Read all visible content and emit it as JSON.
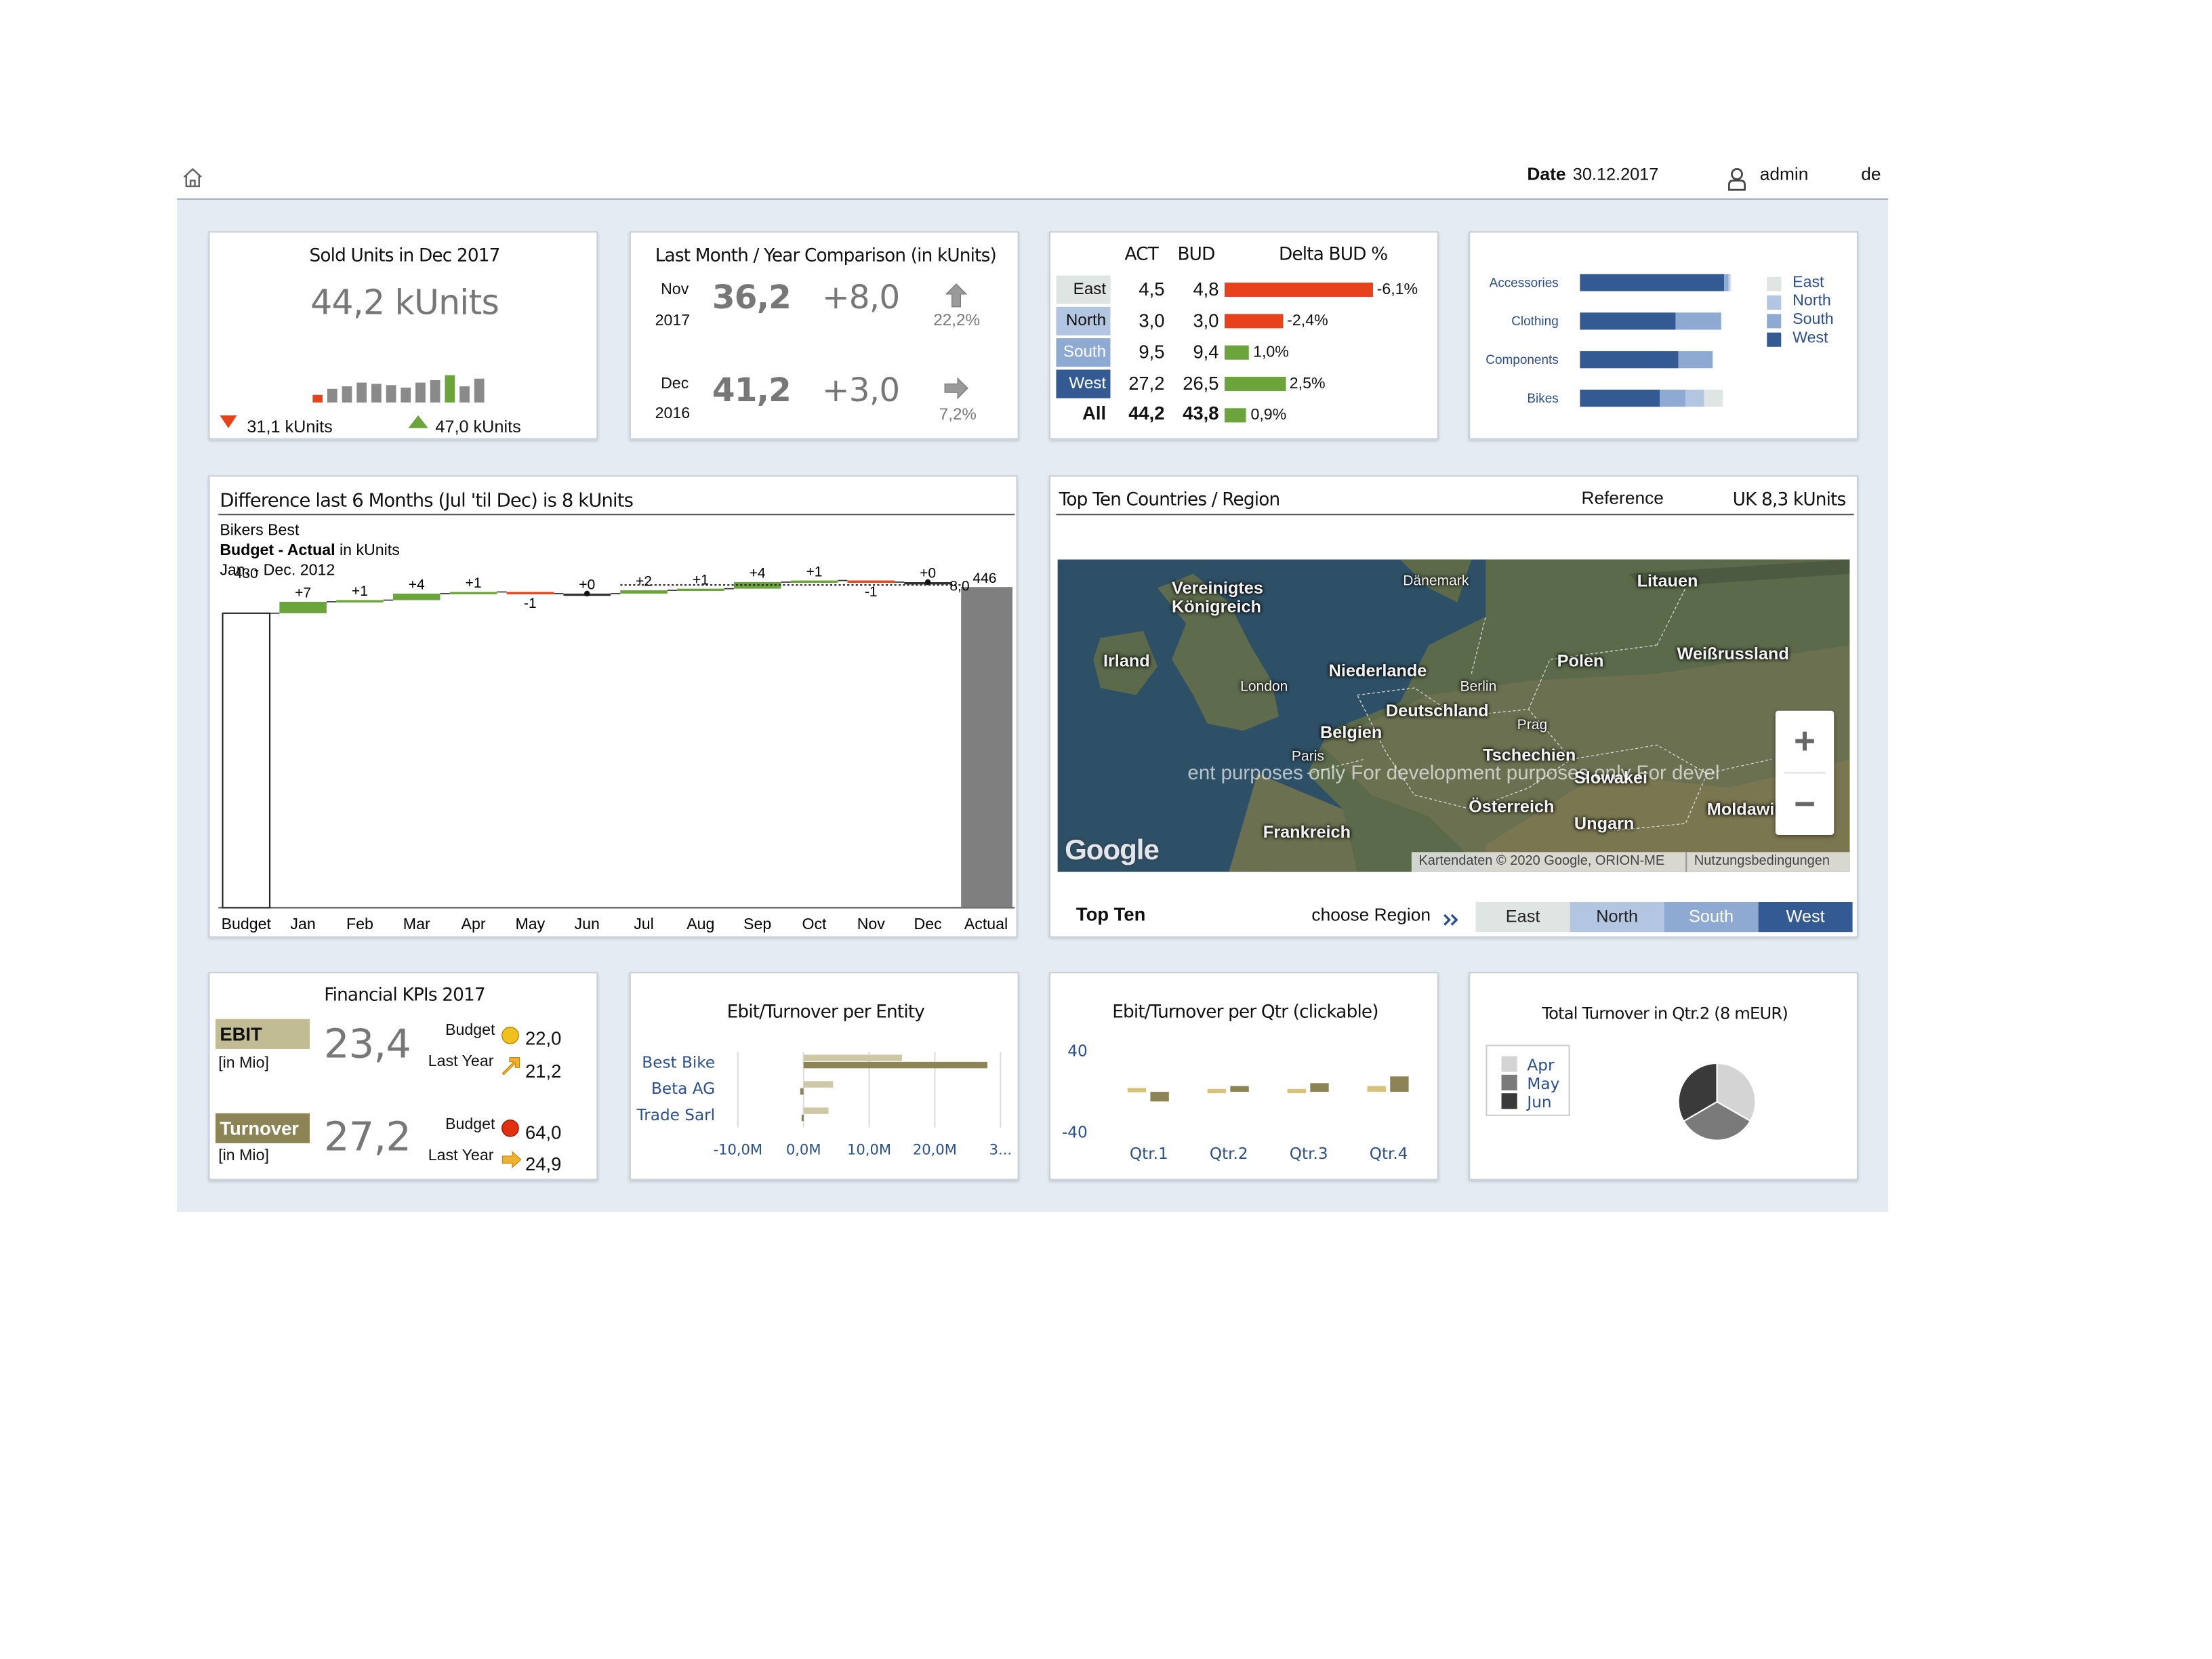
{
  "header": {
    "date_label": "Date",
    "date_value": "30.12.2017",
    "user": "admin",
    "language": "de"
  },
  "sold_units": {
    "title": "Sold Units in Dec 2017",
    "value": "44,2 kUnits",
    "min_label": "31,1 kUnits",
    "max_label": "47,0 kUnits",
    "spark": [
      31.1,
      36,
      38,
      41,
      40,
      39,
      37,
      41,
      43,
      47,
      38,
      44.2
    ],
    "spark_colors": [
      "#e8421c",
      "#8a8a8a",
      "#8a8a8a",
      "#8a8a8a",
      "#8a8a8a",
      "#8a8a8a",
      "#8a8a8a",
      "#8a8a8a",
      "#8a8a8a",
      "#6aa43a",
      "#8a8a8a",
      "#8a8a8a"
    ]
  },
  "comparison": {
    "title": "Last Month / Year Comparison (in kUnits)",
    "rows": [
      {
        "month": "Nov",
        "year": "2017",
        "value": "36,2",
        "delta": "+8,0",
        "pct": "22,2%"
      },
      {
        "month": "Dec",
        "year": "2016",
        "value": "41,2",
        "delta": "+3,0",
        "pct": "7,2%"
      }
    ]
  },
  "region_table": {
    "col_act": "ACT",
    "col_bud": "BUD",
    "col_delta": "Delta BUD %",
    "rows": [
      {
        "region": "East",
        "act": "4,5",
        "bud": "4,8",
        "delta": "-6,1%",
        "delta_value": -6.1,
        "bg": "#dfe5e3",
        "fg": "#111111"
      },
      {
        "region": "North",
        "act": "3,0",
        "bud": "3,0",
        "delta": "-2,4%",
        "delta_value": -2.4,
        "bg": "#b3c6e1",
        "fg": "#111111"
      },
      {
        "region": "South",
        "act": "9,5",
        "bud": "9,4",
        "delta": "1,0%",
        "delta_value": 1.0,
        "bg": "#8eaad3",
        "fg": "#ffffff"
      },
      {
        "region": "West",
        "act": "27,2",
        "bud": "26,5",
        "delta": "2,5%",
        "delta_value": 2.5,
        "bg": "#345a93",
        "fg": "#ffffff"
      }
    ],
    "total": {
      "region": "All",
      "act": "44,2",
      "bud": "43,8",
      "delta": "0,9%",
      "delta_value": 0.9
    }
  },
  "category_chart": {
    "chart_data": {
      "type": "bar",
      "orientation": "horizontal-stacked",
      "categories": [
        "Accessories",
        "Clothing",
        "Components",
        "Bikes"
      ],
      "series": [
        {
          "name": "West",
          "values": [
            95,
            63,
            65,
            53
          ]
        },
        {
          "name": "South",
          "values": [
            3,
            30,
            23,
            17
          ]
        },
        {
          "name": "North",
          "values": [
            1,
            0,
            0,
            12
          ]
        },
        {
          "name": "East",
          "values": [
            1,
            0,
            0,
            12
          ]
        }
      ],
      "legend": [
        "East",
        "North",
        "South",
        "West"
      ],
      "legend_position": "right",
      "colors": {
        "East": "#dfe5e3",
        "North": "#b3c6e1",
        "South": "#8eaad3",
        "West": "#345a93"
      }
    }
  },
  "waterfall": {
    "title": "Difference last 6 Months (Jul 'til Dec) is 8 kUnits",
    "company": "Bikers Best",
    "subtitle_bold": "Budget - Actual",
    "subtitle_rest": "in kUnits",
    "period": "Jan. - Dec. 2012",
    "start_label": "430",
    "end_label": "446",
    "chart_data": {
      "type": "bar",
      "subtype": "waterfall",
      "categories": [
        "Budget",
        "Jan",
        "Feb",
        "Mar",
        "Apr",
        "May",
        "Jun",
        "Jul",
        "Aug",
        "Sep",
        "Oct",
        "Nov",
        "Dec",
        "Actual"
      ],
      "values": [
        430,
        7,
        1,
        4,
        1,
        -1,
        0,
        2,
        1,
        4,
        1,
        -1,
        0,
        446
      ],
      "delta_labels": [
        "",
        "+7",
        "+1",
        "+4",
        "+1",
        "-1",
        "+0",
        "+2",
        "+1",
        "+4",
        "+1",
        "-1",
        "+0",
        ""
      ],
      "extra_label": "8,0"
    }
  },
  "map": {
    "title": "Top Ten Countries / Region",
    "reference_label": "Reference",
    "reference_value": "UK 8,3 kUnits",
    "labels": [
      {
        "text": "Vereinigtes Königreich",
        "cls": ""
      },
      {
        "text": "Irland",
        "cls": ""
      },
      {
        "text": "Dänemark",
        "cls": "small"
      },
      {
        "text": "Litauen",
        "cls": ""
      },
      {
        "text": "Niederlande",
        "cls": ""
      },
      {
        "text": "Polen",
        "cls": ""
      },
      {
        "text": "Weißrussland",
        "cls": ""
      },
      {
        "text": "London",
        "cls": "small"
      },
      {
        "text": "Berlin",
        "cls": "small"
      },
      {
        "text": "Deutschland",
        "cls": ""
      },
      {
        "text": "Belgien",
        "cls": ""
      },
      {
        "text": "Prag",
        "cls": "small"
      },
      {
        "text": "Paris",
        "cls": "small"
      },
      {
        "text": "Tschechien",
        "cls": ""
      },
      {
        "text": "Slowakei",
        "cls": ""
      },
      {
        "text": "Österreich",
        "cls": ""
      },
      {
        "text": "Ungarn",
        "cls": ""
      },
      {
        "text": "Moldawie",
        "cls": ""
      },
      {
        "text": "Frankreich",
        "cls": ""
      }
    ],
    "watermark": "ent purposes only For development purposes only For devel",
    "zoom_in": "+",
    "zoom_out": "−",
    "google_logo": "Google",
    "attribution": "Kartendaten © 2020 Google, ORION-ME",
    "terms": "Nutzungsbedingungen",
    "top_ten_label": "Top Ten",
    "choose_region": "choose Region",
    "regions": [
      "East",
      "North",
      "South",
      "West"
    ]
  },
  "financial": {
    "title": "Financial KPIs 2017",
    "unit": "[in Mio]",
    "budget_label": "Budget",
    "last_year_label": "Last Year",
    "ebit": {
      "label": "EBIT",
      "value": "23,4",
      "budget": "22,0",
      "last_year": "21,2"
    },
    "turnover": {
      "label": "Turnover",
      "value": "27,2",
      "budget": "64,0",
      "last_year": "24,9"
    },
    "colors": {
      "ebit": "#c2bc95",
      "turnover": "#8d8455",
      "yellow": "#f0c020",
      "red": "#e03010",
      "arrow": "#f0b030"
    }
  },
  "entity_chart": {
    "title": "Ebit/Turnover per Entity",
    "chart_data": {
      "type": "bar",
      "orientation": "horizontal",
      "categories": [
        "Best Bike",
        "Beta AG",
        "Trade Sarl"
      ],
      "series": [
        {
          "values": [
            15,
            4.5,
            3.8
          ]
        },
        {
          "values": [
            28,
            -0.5,
            -0.3
          ]
        }
      ],
      "tick_labels": [
        "-10,0M",
        "0,0M",
        "10,0M",
        "20,0M",
        "3..."
      ]
    }
  },
  "qtr_chart": {
    "title": "Ebit/Turnover per Qtr (clickable)",
    "chart_data": {
      "type": "bar",
      "categories": [
        "Qtr.1",
        "Qtr.2",
        "Qtr.3",
        "Qtr.4"
      ],
      "series": [
        {
          "values": [
            4,
            3,
            3,
            6
          ]
        },
        {
          "values": [
            -10,
            6,
            9,
            16
          ]
        }
      ],
      "y_tick_labels": [
        "40",
        "-40"
      ],
      "ylim": [
        -40,
        40
      ]
    }
  },
  "pie_chart": {
    "title": "Total Turnover in Qtr.2 (8 mEUR)",
    "chart_data": {
      "type": "pie",
      "categories": [
        "Apr",
        "May",
        "Jun"
      ],
      "values": [
        33.3,
        33.3,
        33.4
      ],
      "colors": [
        "#d4d4d4",
        "#7a7a7a",
        "#3a3a3a"
      ],
      "legend_position": "left"
    }
  }
}
